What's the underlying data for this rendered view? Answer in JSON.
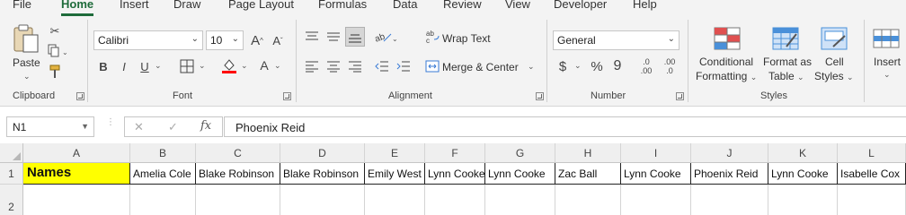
{
  "tabs": [
    "File",
    "Home",
    "Insert",
    "Draw",
    "Page Layout",
    "Formulas",
    "Data",
    "Review",
    "View",
    "Developer",
    "Help"
  ],
  "ribbon": {
    "clipboard": {
      "paste": "Paste",
      "label": "Clipboard"
    },
    "font": {
      "name": "Calibri",
      "size": "10",
      "grow": "A",
      "shrink": "A",
      "bold": "B",
      "italic": "I",
      "underline": "U",
      "color_letter": "A",
      "label": "Font"
    },
    "alignment": {
      "wrap_text": "Wrap Text",
      "merge_center": "Merge & Center",
      "label": "Alignment"
    },
    "number": {
      "format": "General",
      "currency": "$",
      "percent": "%",
      "comma": "9",
      "inc_decimal_top": ".0",
      "inc_decimal_bottom": ".00",
      "dec_decimal_top": ".00",
      "dec_decimal_bottom": ".0",
      "label": "Number"
    },
    "styles": {
      "conditional_1": "Conditional",
      "conditional_2": "Formatting",
      "format_as_1": "Format as",
      "format_as_2": "Table",
      "cell_1": "Cell",
      "cell_2": "Styles",
      "label": "Styles"
    },
    "cells": {
      "insert": "Insert"
    }
  },
  "formula_bar": {
    "name_box": "N1",
    "cancel": "✕",
    "enter": "✓",
    "fx": "fx",
    "value": "Phoenix Reid"
  },
  "grid": {
    "columns": [
      "A",
      "B",
      "C",
      "D",
      "E",
      "F",
      "G",
      "H",
      "I",
      "J",
      "K",
      "L"
    ],
    "rows": [
      "1",
      "2"
    ],
    "row1": [
      "Names",
      "Amelia Cole",
      "Blake Robinson",
      "Blake Robinson",
      "Emily West",
      "Lynn Cooke",
      "Lynn Cooke",
      "Zac Ball",
      "Lynn Cooke",
      "Phoenix Reid",
      "Lynn Cooke",
      "Isabelle Cox"
    ]
  },
  "colors": {
    "accent": "#1e6b3a",
    "header_fill": "#ffff00",
    "font_color_bar": "#ff0000"
  }
}
